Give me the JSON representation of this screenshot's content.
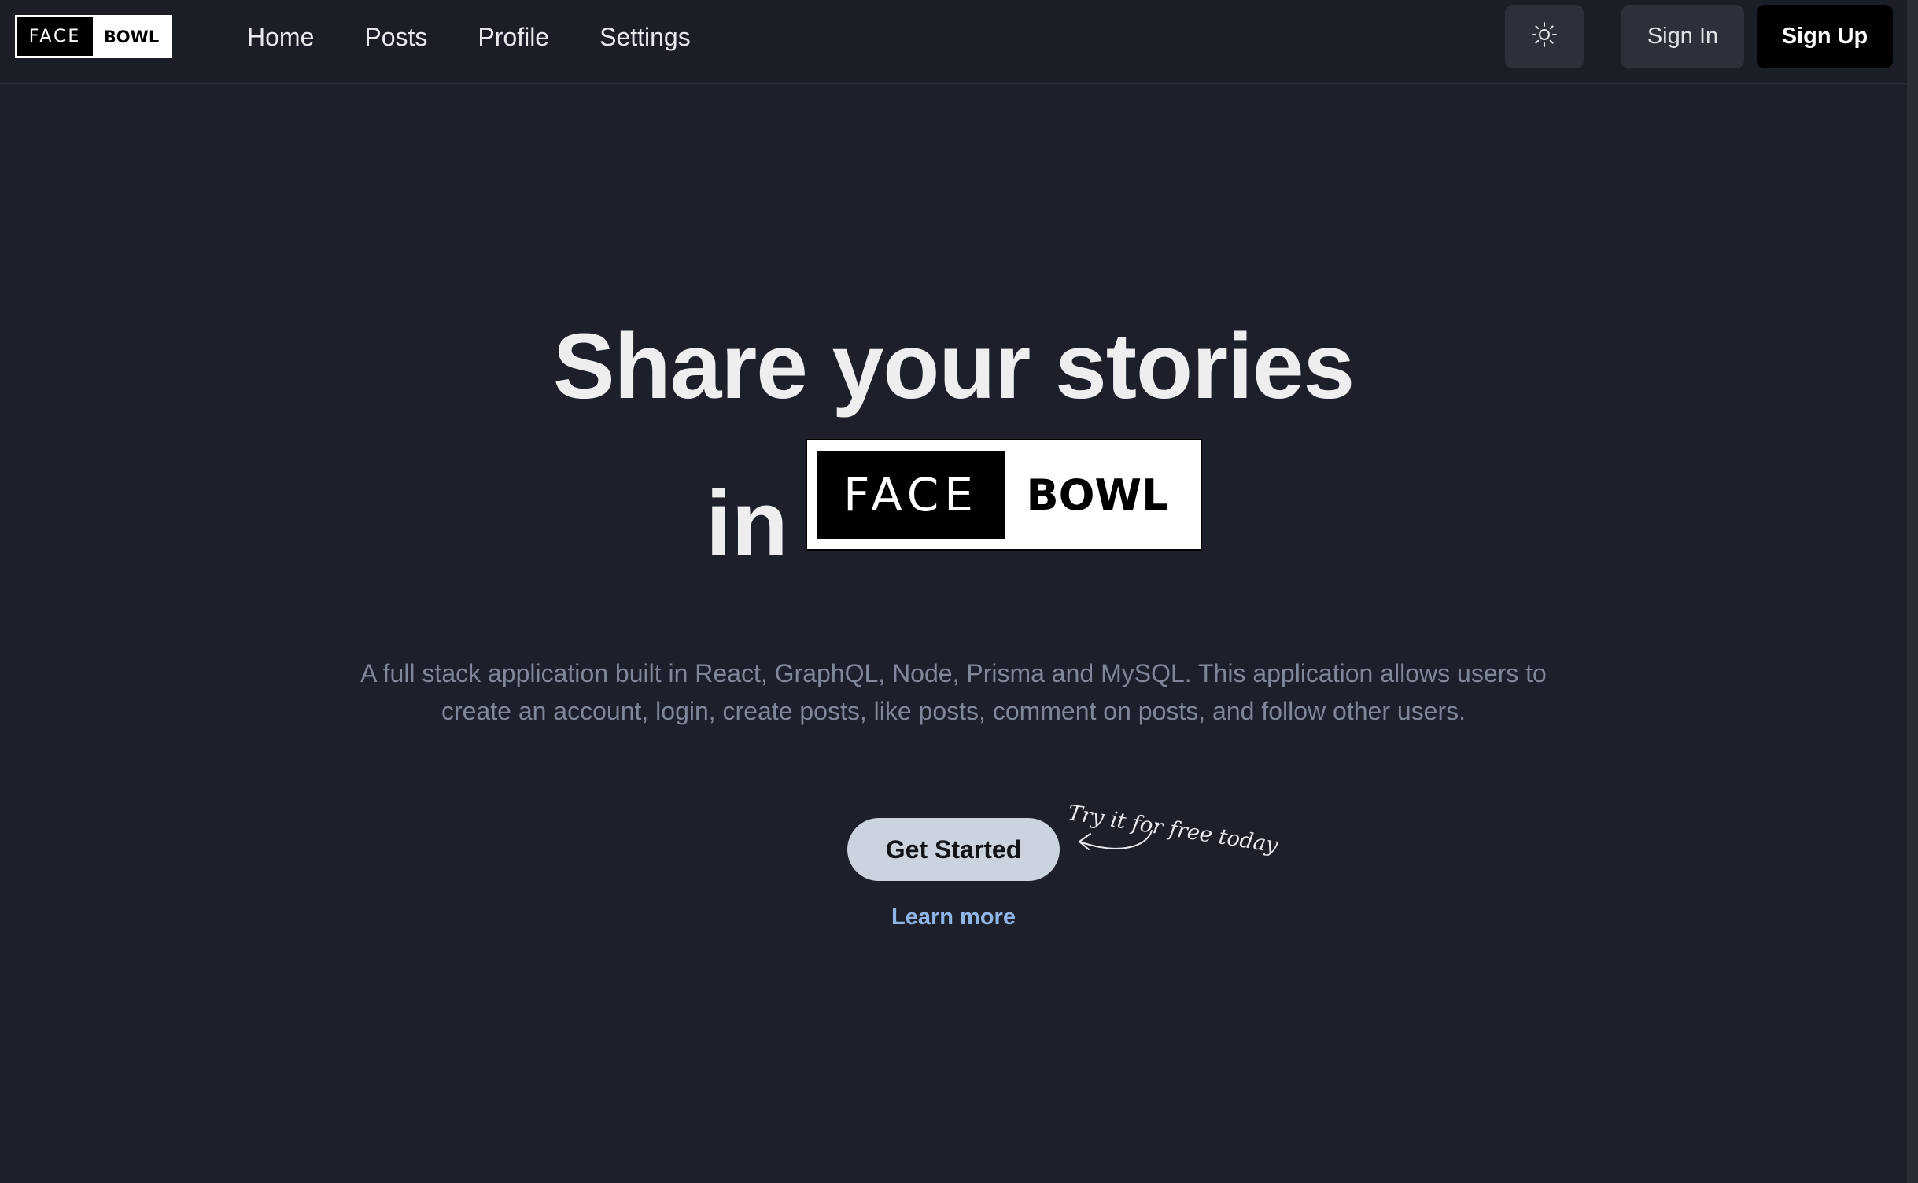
{
  "logo": {
    "face": "FACE",
    "bowl": "BOWL"
  },
  "nav": {
    "links": [
      {
        "label": "Home"
      },
      {
        "label": "Posts"
      },
      {
        "label": "Profile"
      },
      {
        "label": "Settings"
      }
    ],
    "theme_icon": "sun-icon",
    "sign_in_label": "Sign In",
    "sign_up_label": "Sign Up"
  },
  "hero": {
    "title": "Share your stories",
    "in_word": "in",
    "description": "A full stack application built in React, GraphQL, Node, Prisma and MySQL. This application allows users to create an account, login, create posts, like posts, comment on posts, and follow other users.",
    "cta_label": "Get Started",
    "note": "Try it for free today",
    "note_icon": "curved-arrow-icon",
    "learn_more_label": "Learn more"
  },
  "colors": {
    "background": "#1d202a",
    "navbar": "#1b1e27",
    "button_secondary": "#2c303a",
    "button_primary": "#000000",
    "cta": "#cbd3df",
    "link": "#8fb5e6",
    "muted_text": "#7f8799"
  }
}
